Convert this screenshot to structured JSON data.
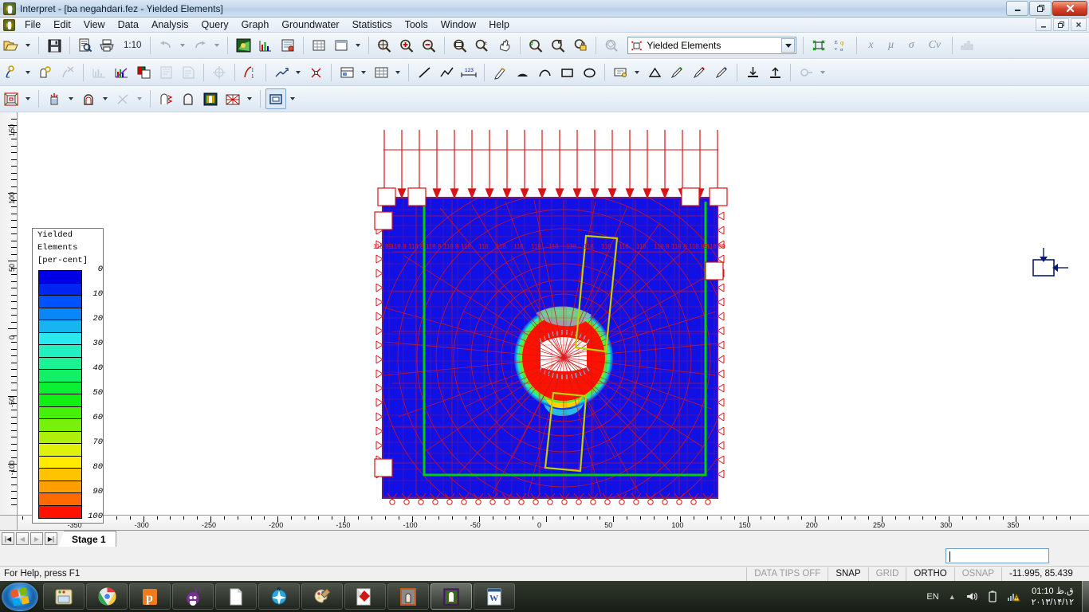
{
  "window": {
    "title": "Interpret - [ba negahdari.fez - Yielded Elements]",
    "app_icon": "rocscience-app-icon",
    "minimize": "–",
    "maximize": "❐",
    "close": "✕",
    "mdi_minimize": "–",
    "mdi_restore": "❐",
    "mdi_close": "✕"
  },
  "menu": {
    "items": [
      {
        "label": "File"
      },
      {
        "label": "Edit"
      },
      {
        "label": "View"
      },
      {
        "label": "Data"
      },
      {
        "label": "Analysis"
      },
      {
        "label": "Query"
      },
      {
        "label": "Graph"
      },
      {
        "label": "Groundwater"
      },
      {
        "label": "Statistics"
      },
      {
        "label": "Tools"
      },
      {
        "label": "Window"
      },
      {
        "label": "Help"
      }
    ]
  },
  "toolbar": {
    "scale_label": "1:10",
    "result_combo": {
      "value": "Yielded Elements",
      "icon": "yielded-elements-icon"
    },
    "stat_symbols": [
      "x",
      "µ",
      "σ",
      "Cv",
      "histogram"
    ]
  },
  "legend": {
    "title_line1": "Yielded",
    "title_line2": "Elements",
    "title_line3": "[per-cent]",
    "values": [
      "0",
      "10",
      "20",
      "30",
      "40",
      "50",
      "60",
      "70",
      "80",
      "90",
      "100"
    ],
    "colors": [
      "#0000e6",
      "#0024f2",
      "#0052ff",
      "#0b86f7",
      "#16b5f0",
      "#29e8ef",
      "#22f0c0",
      "#1bf294",
      "#12f066",
      "#0bf033",
      "#12ef12",
      "#45f00b",
      "#79f00b",
      "#aef00b",
      "#dff00b",
      "#ffeb00",
      "#ffc400",
      "#ff9e00",
      "#ff6a00",
      "#ff1200"
    ]
  },
  "chart_data": {
    "type": "heatmap",
    "title": "Yielded Elements",
    "units": "per-cent",
    "xlabel": "",
    "ylabel": "",
    "xlim": [
      -380,
      395
    ],
    "ylim": [
      -140,
      165
    ],
    "x_ticks": [
      "-350",
      "-300",
      "-250",
      "-200",
      "-150",
      "-100",
      "-50",
      "0",
      "50",
      "100",
      "150",
      "200",
      "250",
      "300",
      "350"
    ],
    "y_ticks": [
      "150",
      "100",
      "50",
      "0",
      "-50",
      "-100"
    ],
    "grid": false,
    "legend_position": "left",
    "colorbar_range": [
      0,
      100
    ],
    "colorbar_step": 5,
    "load_label_value": "118.89",
    "load_labels": [
      "118.89",
      "118.8",
      "118.8",
      "118.8",
      "118.8",
      "118.",
      "118.",
      "118.",
      "118.",
      "118.",
      "118.",
      "118.",
      "118.",
      "118.",
      "118.",
      "118.",
      "118.8",
      "118.8",
      "118.89",
      "118.89"
    ],
    "notes": "Finite element mesh of a tunnel excavation; blue = 0% yielded elements (far field), red ring = 100% yielded elements around the tunnel opening; green polyline marks the external boundary / support region."
  },
  "axis_widget": {
    "name": "load-direction-indicator"
  },
  "stagebar": {
    "first": "|◀",
    "prev": "◀",
    "next": "▶",
    "last": "▶|",
    "tab_label": "Stage 1"
  },
  "message_box": {
    "value": "",
    "placeholder": ""
  },
  "statusbar": {
    "help": "For Help, press F1",
    "data_tips": "DATA TIPS OFF",
    "snap": "SNAP",
    "grid": "GRID",
    "ortho": "ORTHO",
    "osnap": "OSNAP",
    "coords": "-11.995,  85.439"
  },
  "taskbar": {
    "start": "start-orb",
    "items": [
      {
        "name": "file-explorer",
        "icon": "folder-icon"
      },
      {
        "name": "google-chrome",
        "icon": "chrome-icon"
      },
      {
        "name": "pdf-app",
        "icon": "p-letter-icon"
      },
      {
        "name": "yahoo-messenger",
        "icon": "yahoo-icon"
      },
      {
        "name": "notepad-document",
        "icon": "document-icon"
      },
      {
        "name": "compass-app",
        "icon": "compass-icon"
      },
      {
        "name": "paint-app",
        "icon": "palette-icon"
      },
      {
        "name": "rocscience-phase2",
        "icon": "red-diamond-icon"
      },
      {
        "name": "rock-app",
        "icon": "rock-tunnel-icon"
      },
      {
        "name": "interpret-app",
        "icon": "interpret-icon"
      },
      {
        "name": "microsoft-word",
        "icon": "word-icon"
      }
    ],
    "tray": {
      "language": "EN",
      "show_hidden": "▲",
      "volume": "volume-icon",
      "battery": "battery-icon",
      "network": "network-warning-icon",
      "time": "01:10 ق.ظ",
      "date": "۲۰۱۳/۱۴/۱۲"
    }
  }
}
